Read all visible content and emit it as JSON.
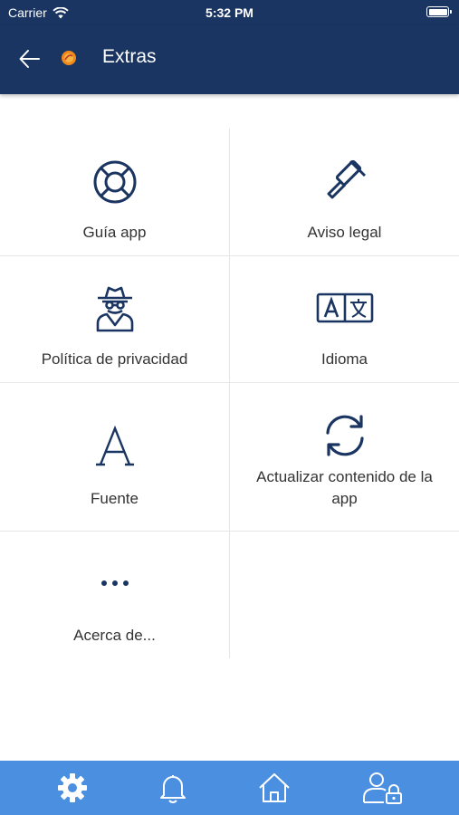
{
  "status_bar": {
    "carrier": "Carrier",
    "time": "5:32 PM"
  },
  "header": {
    "title": "Extras",
    "icons": [
      "arrow-left-icon",
      "app-logo-icon"
    ]
  },
  "menu": {
    "items": [
      {
        "label": "Guía app",
        "icon": "lifebuoy-icon"
      },
      {
        "label": "Aviso legal",
        "icon": "gavel-icon"
      },
      {
        "label": "Política de privacidad",
        "icon": "spy-icon"
      },
      {
        "label": "Idioma",
        "icon": "translate-icon"
      },
      {
        "label": "Fuente",
        "icon": "font-icon"
      },
      {
        "label": "Actualizar contenido de la app",
        "icon": "refresh-icon"
      },
      {
        "label": "Acerca de...",
        "icon": "more-icon"
      }
    ]
  },
  "tab_bar": {
    "tabs": [
      {
        "name": "settings",
        "icon": "gear-icon",
        "active": true
      },
      {
        "name": "notifications",
        "icon": "bell-icon",
        "active": false
      },
      {
        "name": "home",
        "icon": "home-icon",
        "active": false
      },
      {
        "name": "account",
        "icon": "user-lock-icon",
        "active": false
      }
    ]
  },
  "colors": {
    "header_bg": "#1a3561",
    "icon": "#1a3561",
    "text": "#333333",
    "tab_bar_bg": "#4a8fe0",
    "divider": "#e6e6e6"
  }
}
